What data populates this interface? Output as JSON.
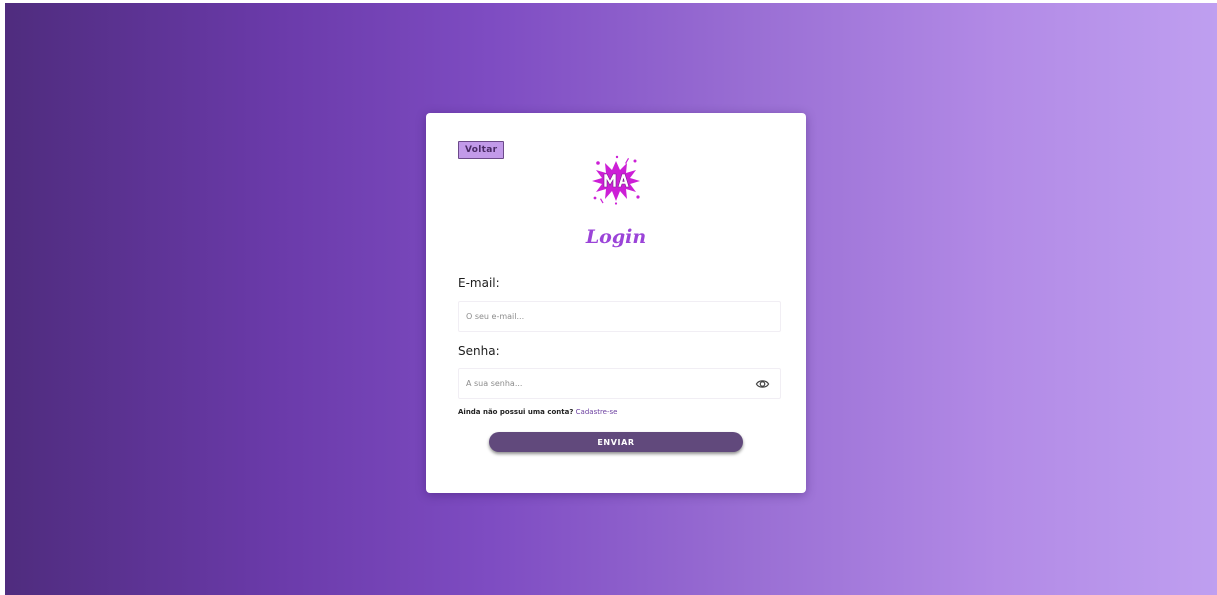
{
  "login": {
    "back_label": "Voltar",
    "title": "Login",
    "email_label": "E-mail:",
    "email_placeholder": "O seu e-mail...",
    "password_label": "Senha:",
    "password_placeholder": "A sua senha...",
    "signup_question": "Ainda não possui uma conta?",
    "signup_link": "Cadastre-se",
    "submit_label": "ENVIAR"
  },
  "icons": {
    "logo": "paint-splash-logo-icon",
    "password_toggle": "eye-icon"
  },
  "colors": {
    "gradient_start": "#4f2c7e",
    "gradient_end": "#bf9ff0",
    "accent": "#9b44d8",
    "button": "#61497c",
    "back_button": "#c29ae9",
    "link": "#6b3fa0"
  }
}
